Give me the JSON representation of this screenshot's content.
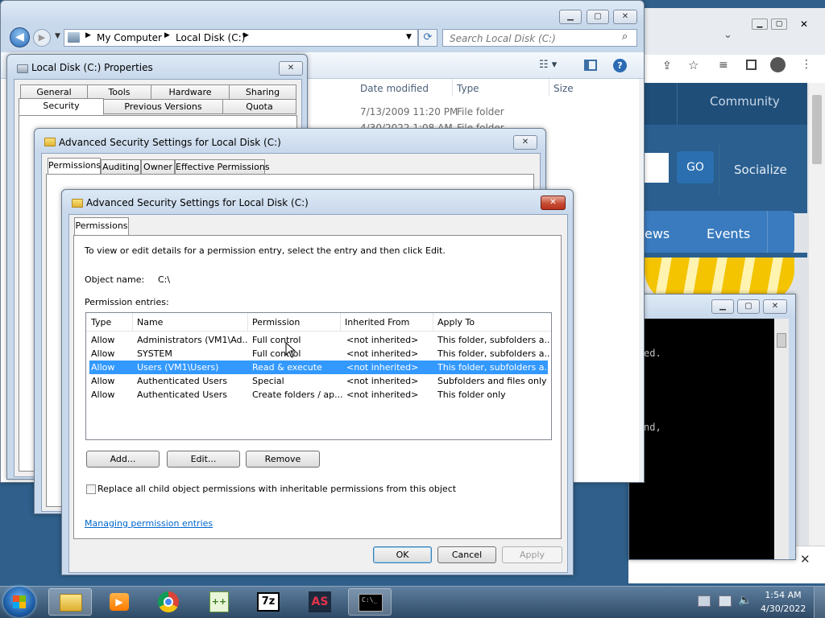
{
  "explorer": {
    "breadcrumb": [
      "My Computer",
      "Local Disk (C:)"
    ],
    "search_placeholder": "Search Local Disk (C:)",
    "columns": [
      "Date modified",
      "Type",
      "Size"
    ],
    "rows": [
      {
        "date": "7/13/2009 11:20 PM",
        "type": "File folder"
      },
      {
        "date": "4/30/2022 1:08 AM",
        "type": "File folder"
      }
    ]
  },
  "properties": {
    "title": "Local Disk (C:) Properties",
    "tabs_row1": [
      "General",
      "Tools",
      "Hardware",
      "Sharing"
    ],
    "tabs_row2": [
      "Security",
      "Previous Versions",
      "Quota"
    ]
  },
  "adv_back": {
    "title": "Advanced Security Settings for Local Disk (C:)",
    "tabs": [
      "Permissions",
      "Auditing",
      "Owner",
      "Effective Permissions"
    ]
  },
  "adv_front": {
    "title": "Advanced Security Settings for Local Disk (C:)",
    "tab": "Permissions",
    "instructions": "To view or edit details for a permission entry, select the entry and then click Edit.",
    "object_label": "Object name:",
    "object_value": "C:\\",
    "entries_label": "Permission entries:",
    "columns": [
      "Type",
      "Name",
      "Permission",
      "Inherited From",
      "Apply To"
    ],
    "rows": [
      {
        "type": "Allow",
        "name": "Administrators (VM1\\Ad...",
        "permission": "Full control",
        "inherited": "<not inherited>",
        "apply": "This folder, subfolders a..."
      },
      {
        "type": "Allow",
        "name": "SYSTEM",
        "permission": "Full control",
        "inherited": "<not inherited>",
        "apply": "This folder, subfolders a..."
      },
      {
        "type": "Allow",
        "name": "Users (VM1\\Users)",
        "permission": "Read & execute",
        "inherited": "<not inherited>",
        "apply": "This folder, subfolders a..."
      },
      {
        "type": "Allow",
        "name": "Authenticated Users",
        "permission": "Special",
        "inherited": "<not inherited>",
        "apply": "Subfolders and files only"
      },
      {
        "type": "Allow",
        "name": "Authenticated Users",
        "permission": "Create folders / ap...",
        "inherited": "<not inherited>",
        "apply": "This folder only"
      }
    ],
    "add_label": "Add...",
    "edit_label": "Edit...",
    "remove_label": "Remove",
    "replace_label": "Replace all child object permissions with inheritable permissions from this object",
    "link_label": "Managing permission entries",
    "ok_label": "OK",
    "cancel_label": "Cancel",
    "apply_label": "Apply"
  },
  "browser": {
    "nav_community": "Community",
    "go_label": "GO",
    "socialize": "Socialize",
    "news_partial": "ews",
    "events": "Events"
  },
  "console": {
    "line1": "ed.",
    "line2": "nd,"
  },
  "taskbar": {
    "time": "1:54 AM",
    "date": "4/30/2022",
    "apps": [
      "explorer",
      "media-player",
      "chrome",
      "notepad-plus",
      "7-zip",
      "app-studio",
      "command-prompt"
    ]
  },
  "colors": {
    "selection": "#3399ff",
    "site_blue": "#2a5f8f",
    "site_accent": "#ffcc00"
  }
}
